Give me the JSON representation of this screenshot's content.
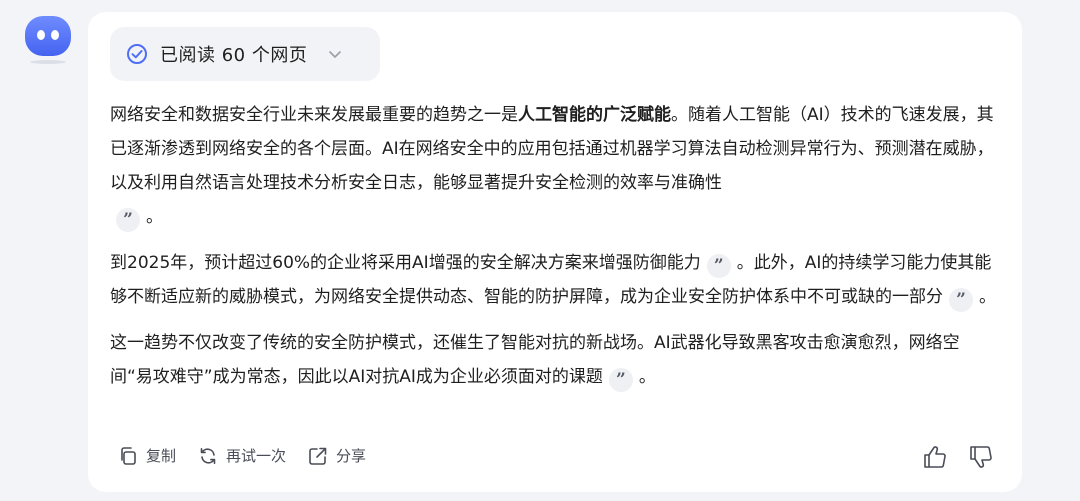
{
  "read_pill": {
    "label": "已阅读 60 个网页"
  },
  "paragraphs": [
    {
      "before": "网络安全和数据安全行业未来发展最重要的趋势之一是",
      "bold": "人工智能的广泛赋能",
      "after": "。随着人工智能（AI）技术的飞速发展，其已逐渐渗透到网络安全的各个层面。AI在网络安全中的应用包括通过机器学习算法自动检测异常行为、预测潜在威胁，以及利用自然语言处理技术分析安全日志，能够显著提升安全检测的效率与准确性",
      "end": "。"
    },
    {
      "before": "到2025年，预计超过60%的企业将采用AI增强的安全解决方案来增强防御能力",
      "middle": "。此外，AI的持续学习能力使其能够不断适应新的威胁模式，为网络安全提供动态、智能的防护屏障，成为企业安全防护体系中不可或缺的一部分",
      "end": "。"
    },
    {
      "before": "这一趋势不仅改变了传统的安全防护模式，还催生了智能对抗的新战场。AI武器化导致黑客攻击愈演愈烈，网络空间“易攻难守”成为常态，因此以AI对抗AI成为企业必须面对的课题",
      "end": "。"
    }
  ],
  "citation_glyph": "”",
  "actions": {
    "copy": "复制",
    "retry": "再试一次",
    "share": "分享"
  },
  "icons": {
    "avatar": "bot-avatar-icon",
    "check": "check-circle-icon",
    "chevron": "chevron-down-icon",
    "copy": "copy-icon",
    "retry": "refresh-icon",
    "share": "share-icon",
    "like": "thumbs-up-icon",
    "dislike": "thumbs-down-icon"
  },
  "colors": {
    "accent": "#4f6ef7",
    "avatar": "#5b7cf9"
  }
}
